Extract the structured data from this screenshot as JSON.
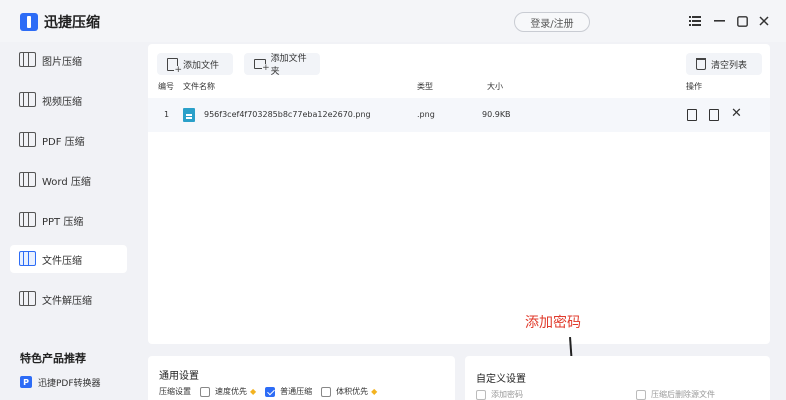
{
  "app": {
    "title": "迅捷压缩",
    "login_label": "登录/注册",
    "window_controls": [
      "menu-icon",
      "minimize-icon",
      "maximize-icon",
      "close-icon"
    ]
  },
  "sidebar": {
    "items": [
      {
        "label": "图片压缩",
        "icon": "image-compress-icon",
        "active": false
      },
      {
        "label": "视频压缩",
        "icon": "video-compress-icon",
        "active": false
      },
      {
        "label": "PDF 压缩",
        "icon": "pdf-compress-icon",
        "active": false
      },
      {
        "label": "Word 压缩",
        "icon": "word-compress-icon",
        "active": false
      },
      {
        "label": "PPT 压缩",
        "icon": "ppt-compress-icon",
        "active": false
      },
      {
        "label": "文件压缩",
        "icon": "file-compress-icon",
        "active": true
      },
      {
        "label": "文件解压缩",
        "icon": "file-decompress-icon",
        "active": false
      }
    ],
    "featured_title": "特色产品推荐",
    "featured_item": {
      "label": "迅捷PDF转换器",
      "icon": "pdf-converter-icon",
      "badge": "P"
    }
  },
  "toolbar": {
    "add_file": "添加文件",
    "add_folder": "添加文件夹",
    "clear_list": "清空列表"
  },
  "table": {
    "columns": {
      "index": "编号",
      "name": "文件名称",
      "type": "类型",
      "size": "大小",
      "actions": "操作"
    },
    "rows": [
      {
        "index": "1",
        "name": "956f3cef4f703285b8c77eba12e2670.png",
        "type": ".png",
        "size": "90.9KB"
      }
    ]
  },
  "annotation": {
    "text": "添加密码",
    "color": "#e03a2b"
  },
  "general_settings": {
    "title": "通用设置",
    "label": "压缩设置",
    "options": [
      {
        "label": "速度优先",
        "checked": false,
        "premium": true
      },
      {
        "label": "普通压缩",
        "checked": true,
        "premium": false
      },
      {
        "label": "体积优先",
        "checked": false,
        "premium": true
      }
    ]
  },
  "custom_settings": {
    "title": "自定义设置",
    "options": [
      {
        "label": "添加密码",
        "checked": false
      },
      {
        "label": "压缩后删除源文件",
        "checked": false
      }
    ]
  },
  "colors": {
    "accent": "#2d6cf6",
    "background": "#f1f2f6",
    "row_highlight": "#f5f7fb"
  }
}
